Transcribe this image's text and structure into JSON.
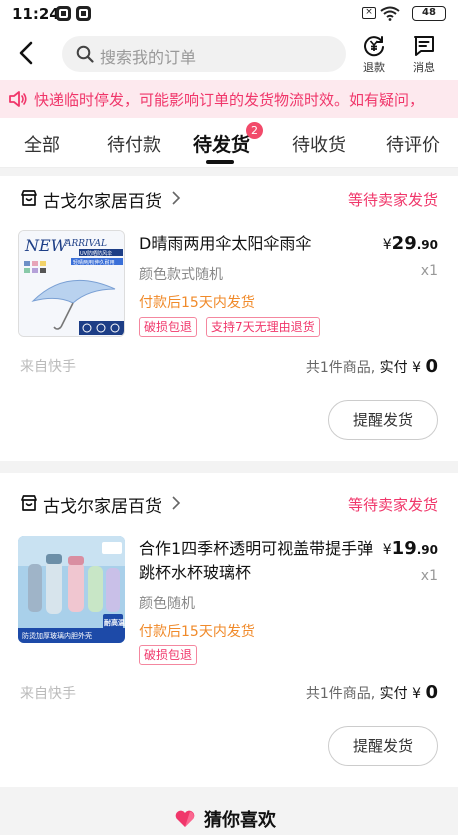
{
  "status_bar": {
    "time": "11:24",
    "battery": "48"
  },
  "top_nav": {
    "search_placeholder": "搜索我的订单",
    "refund_label": "退款",
    "message_label": "消息"
  },
  "notice": {
    "text": "快递临时停发，可能影响订单的发货物流时效。如有疑问，"
  },
  "tabs": [
    {
      "label": "全部"
    },
    {
      "label": "待付款"
    },
    {
      "label": "待发货",
      "active": true,
      "badge": "2"
    },
    {
      "label": "待收货"
    },
    {
      "label": "待评价"
    }
  ],
  "orders": [
    {
      "shop_name": "古戈尔家居百货",
      "status": "等待卖家发货",
      "title": "D晴雨两用伞太阳伞雨伞",
      "spec": "颜色款式随机",
      "ship_note": "付款后15天内发货",
      "tags": [
        "破损包退",
        "支持7天无理由退货"
      ],
      "price_yen": "¥",
      "price_int": "29",
      "price_dec": ".90",
      "qty": "x1",
      "source": "来自快手",
      "summary_prefix": "共1件商品,",
      "summary_paid": "实付",
      "summary_yen": "¥",
      "summary_total": "0",
      "action": "提醒发货",
      "thumb_text": {
        "brand1": "NEW",
        "brand2": "ARRIVAL",
        "sub": "UV防晒防风伞",
        "band": "轻晴两用|伸久耐用"
      }
    },
    {
      "shop_name": "古戈尔家居百货",
      "status": "等待卖家发货",
      "title": "合作1四季杯透明可视盖带提手弹跳杯水杯玻璃杯",
      "spec": "颜色随机",
      "ship_note": "付款后15天内发货",
      "tags": [
        "破损包退"
      ],
      "price_yen": "¥",
      "price_int": "19",
      "price_dec": ".90",
      "qty": "x1",
      "source": "来自快手",
      "summary_prefix": "共1件商品,",
      "summary_paid": "实付",
      "summary_yen": "¥",
      "summary_total": "0",
      "action": "提醒发货",
      "thumb_text": {
        "badge": "耐高温",
        "banner": "防烫加厚玻璃内胆外壳"
      }
    }
  ],
  "guess": {
    "label": "猜你喜欢"
  },
  "colors": {
    "accent": "#f0366a",
    "orange": "#f08a2a",
    "notice_bg": "#fde9ee"
  }
}
